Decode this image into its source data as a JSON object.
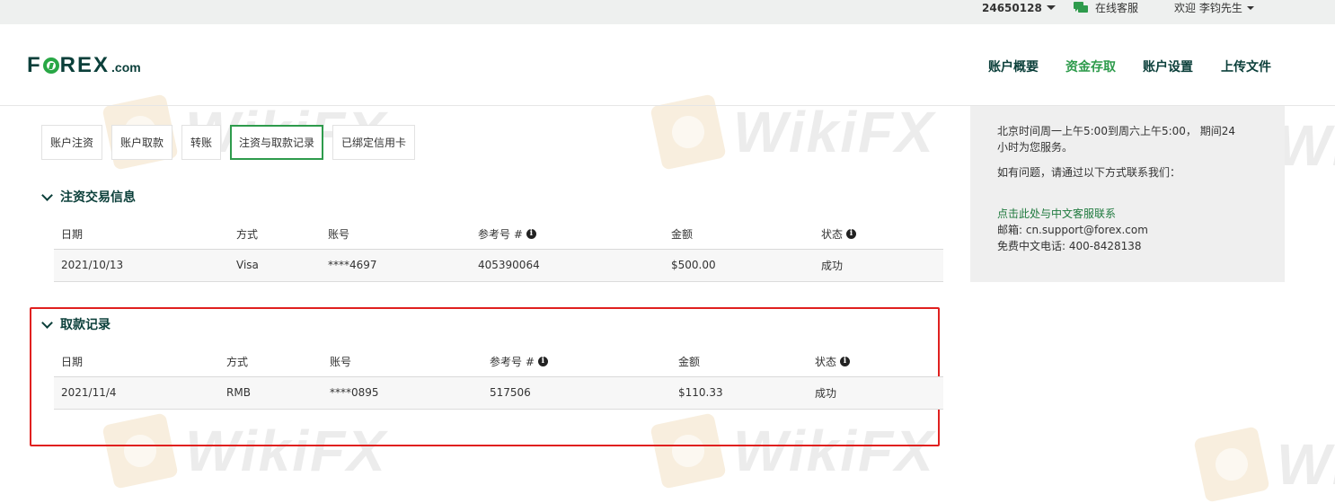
{
  "topbar": {
    "account_number": "24650128",
    "online_support": "在线客服",
    "welcome": "欢迎 李钧先生"
  },
  "brand": {
    "logo_main_1": "F",
    "logo_main_2": "REX",
    "logo_domain": ".com"
  },
  "nav": {
    "items": [
      "账户概要",
      "资金存取",
      "账户设置",
      "上传文件"
    ],
    "active_index": 1
  },
  "tabs": {
    "items": [
      "账户注资",
      "账户取款",
      "转账",
      "注资与取款记录",
      "已绑定信用卡"
    ],
    "active_index": 3
  },
  "deposits": {
    "title": "注资交易信息",
    "columns": [
      "日期",
      "方式",
      "账号",
      "参考号 #",
      "金额",
      "状态"
    ],
    "rows": [
      [
        "2021/10/13",
        "Visa",
        "****4697",
        "405390064",
        "$500.00",
        "成功"
      ]
    ]
  },
  "withdrawals": {
    "title": "取款记录",
    "columns": [
      "日期",
      "方式",
      "账号",
      "参考号 #",
      "金额",
      "状态"
    ],
    "rows": [
      [
        "2021/11/4",
        "RMB",
        "****0895",
        "517506",
        "$110.33",
        "成功"
      ]
    ]
  },
  "support_panel": {
    "hours_line1": "北京时间周一上午5:00到周六上午5:00， 期间24",
    "hours_line2": "小时为您服务。",
    "contact_intro": "如有问题，请通过以下方式联系我们：",
    "chat_link": "点击此处与中文客服联系",
    "email": "邮箱: cn.support@forex.com",
    "phone": "免费中文电话: 400-8428138"
  },
  "watermark": {
    "text": "WikiFX"
  },
  "colors": {
    "brand_dark": "#0b3f3a",
    "brand_green": "#2e9b4c",
    "highlight_red": "#e0201f",
    "panel_bg": "#efefef"
  }
}
